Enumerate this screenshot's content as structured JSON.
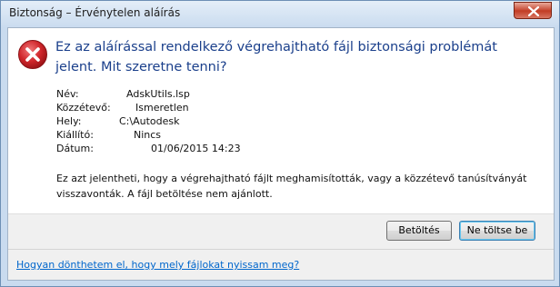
{
  "window": {
    "title": "Biztonság – Érvénytelen aláírás",
    "close_icon": "close-icon"
  },
  "dialog": {
    "icon": "error-icon",
    "headline": "Ez az aláírással rendelkező végrehajtható fájl biztonsági problémát jelent. Mit szeretne tenni?",
    "details": [
      {
        "label": "Név:",
        "value": "AdskUtils.lsp"
      },
      {
        "label": "Közzétevő:",
        "value": "Ismeretlen"
      },
      {
        "label": "Hely:",
        "value": "C:\\Autodesk"
      },
      {
        "label": "Kiállító:",
        "value": "Nincs"
      },
      {
        "label": "Dátum:",
        "value": "01/06/2015 14:23"
      }
    ],
    "warning": "Ez azt jelentheti, hogy a végrehajtható fájlt meghamisították, vagy a közzétevő tanúsítványát visszavonták. A fájl betöltése nem ajánlott."
  },
  "buttons": {
    "load": "Betöltés",
    "do_not_load": "Ne töltse be"
  },
  "footer": {
    "help_link": "Hogyan dönthetem el, hogy mely fájlokat nyissam meg?"
  },
  "colors": {
    "headline": "#1a3f8b",
    "link": "#0066cc",
    "error_red": "#c8262a"
  }
}
